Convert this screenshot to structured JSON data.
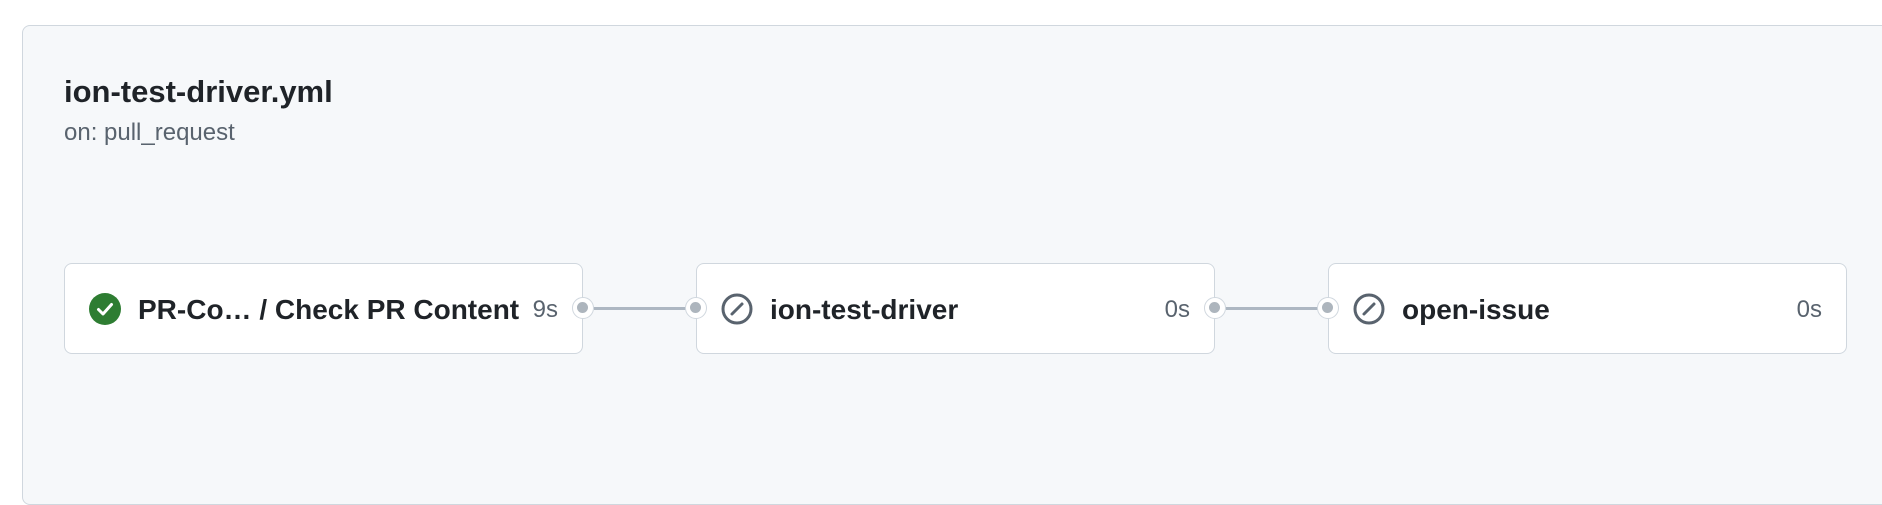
{
  "workflow": {
    "title": "ion-test-driver.yml",
    "trigger": "on: pull_request"
  },
  "jobs": [
    {
      "name": "PR-Co… / Check PR Content",
      "duration": "9s",
      "status": "success",
      "icon": "check-circle-fill-icon"
    },
    {
      "name": "ion-test-driver",
      "duration": "0s",
      "status": "skipped",
      "icon": "skip-icon"
    },
    {
      "name": "open-issue",
      "duration": "0s",
      "status": "skipped",
      "icon": "skip-icon"
    }
  ],
  "colors": {
    "success": "#1a7f37",
    "skipped": "#59636e",
    "connector": "#adb7c2"
  }
}
